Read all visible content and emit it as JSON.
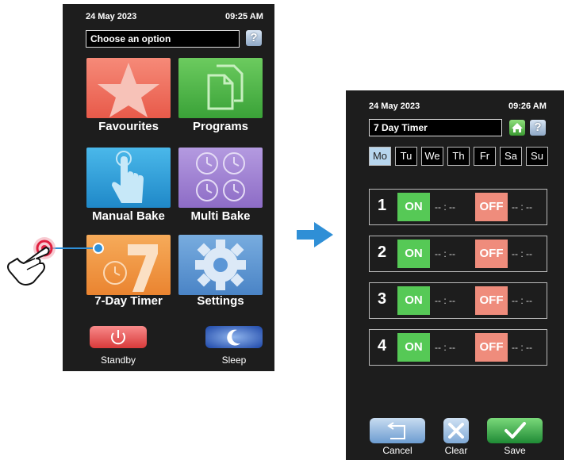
{
  "screen1": {
    "date": "24 May 2023",
    "time": "09:25 AM",
    "title": "Choose an option",
    "help_label": "?",
    "tiles": [
      {
        "label": "Favourites",
        "icon": "star-icon",
        "color": "#f26d5b"
      },
      {
        "label": "Programs",
        "icon": "documents-icon",
        "color": "#4cb54a"
      },
      {
        "label": "Manual Bake",
        "icon": "hand-touch-icon",
        "color": "#2ea3dc"
      },
      {
        "label": "Multi Bake",
        "icon": "clocks-icon",
        "color": "#9e7fd0"
      },
      {
        "label": "7-Day Timer",
        "icon": "seven-clock-icon",
        "color": "#f0953a"
      },
      {
        "label": "Settings",
        "icon": "gear-icon",
        "color": "#5b96d6"
      }
    ],
    "standby_label": "Standby",
    "sleep_label": "Sleep"
  },
  "screen2": {
    "date": "24 May 2023",
    "time": "09:26 AM",
    "title": "7  Day  Timer",
    "help_label": "?",
    "days": [
      "Mo",
      "Tu",
      "We",
      "Th",
      "Fr",
      "Sa",
      "Su"
    ],
    "active_day": "Mo",
    "timers": [
      {
        "num": "1",
        "on_label": "ON",
        "on_time": "-- : --",
        "off_label": "OFF",
        "off_time": "-- : --"
      },
      {
        "num": "2",
        "on_label": "ON",
        "on_time": "-- : --",
        "off_label": "OFF",
        "off_time": "-- : --"
      },
      {
        "num": "3",
        "on_label": "ON",
        "on_time": "-- : --",
        "off_label": "OFF",
        "off_time": "-- : --"
      },
      {
        "num": "4",
        "on_label": "ON",
        "on_time": "-- : --",
        "off_label": "OFF",
        "off_time": "-- : --"
      }
    ],
    "cancel_label": "Cancel",
    "clear_label": "Clear",
    "save_label": "Save"
  },
  "colors": {
    "screen_bg": "#1d1d1d",
    "arrow": "#2f8fd6",
    "pointer": "#e02040",
    "on_green": "#56c956",
    "off_red": "#ef8c7c",
    "active_day": "#b7d6ee"
  }
}
